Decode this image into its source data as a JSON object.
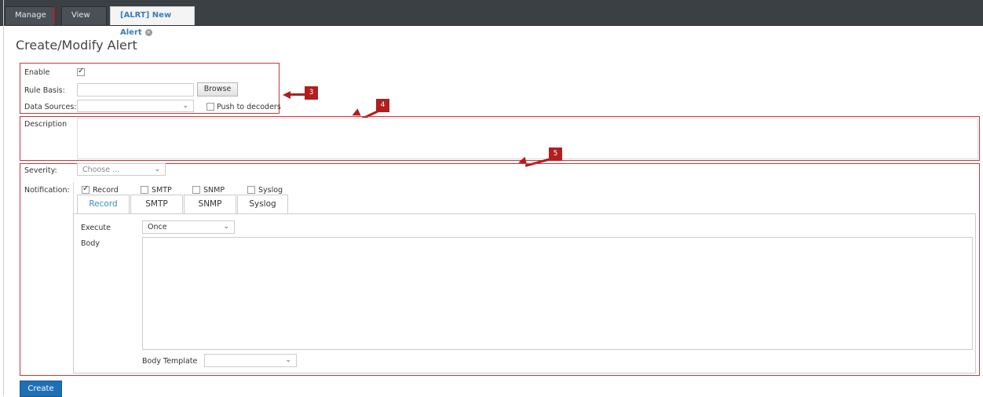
{
  "tabs": {
    "manage": "Manage",
    "view": "View",
    "active": "[ALRT] New Alert",
    "active_close_icon": "x-circle-icon"
  },
  "page": {
    "title": "Create/Modify Alert"
  },
  "form": {
    "enable_label": "Enable",
    "enable_checked": true,
    "rule_basis_label": "Rule Basis:",
    "rule_basis_value": "",
    "browse_label": "Browse",
    "data_sources_label": "Data Sources:",
    "data_sources_value": "",
    "push_label": "Push to decoders",
    "push_checked": false,
    "description_label": "Description",
    "description_value": "",
    "severity_label": "Severity:",
    "severity_value": "Choose ...",
    "notification_label": "Notification:",
    "notifications": [
      {
        "label": "Record",
        "checked": true
      },
      {
        "label": "SMTP",
        "checked": false
      },
      {
        "label": "SNMP",
        "checked": false
      },
      {
        "label": "Syslog",
        "checked": false
      }
    ]
  },
  "notification_tabs": [
    "Record",
    "SMTP",
    "SNMP",
    "Syslog"
  ],
  "record_panel": {
    "execute_label": "Execute",
    "execute_value": "Once",
    "body_label": "Body",
    "body_value": "",
    "body_template_label": "Body Template",
    "body_template_value": ""
  },
  "markers": [
    "3",
    "4",
    "5"
  ],
  "actions": {
    "create_label": "Create"
  },
  "colors": {
    "accent": "#1f6fb6",
    "highlight": "#c8383a",
    "tab_active_text": "#3a8fc7"
  }
}
